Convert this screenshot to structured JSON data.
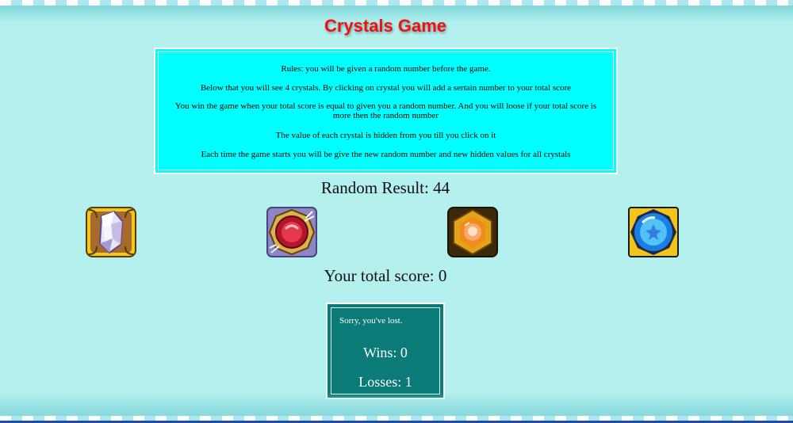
{
  "title": "Crystals Game",
  "rules": [
    "Rules: you will be given a random number before the game.",
    "Below that you will see 4 crystals. By clicking on crystal you will add a sertain number to your total score",
    "You win the game when your total score is equal to given you a random number. And you will loose if your total score is more then the random number",
    "The value of each crystal is hidden from you till you click on it",
    "Each time the game starts you will be give the new random number and new hidden values for all crystals"
  ],
  "random_result": "Random Result: 44",
  "crystals": [
    {
      "icon": "white-crystal-icon"
    },
    {
      "icon": "red-gem-icon"
    },
    {
      "icon": "orange-gem-icon"
    },
    {
      "icon": "blue-gem-icon"
    }
  ],
  "total_score": "Your total score: 0",
  "stats": {
    "status": "Sorry, you've lost.",
    "wins": "Wins: 0",
    "losses": "Losses: 1"
  },
  "colors": {
    "background": "#b4f0ee",
    "title": "#ee1111",
    "rules_box": "#00ffff",
    "stats_box": "#0a7b76"
  }
}
